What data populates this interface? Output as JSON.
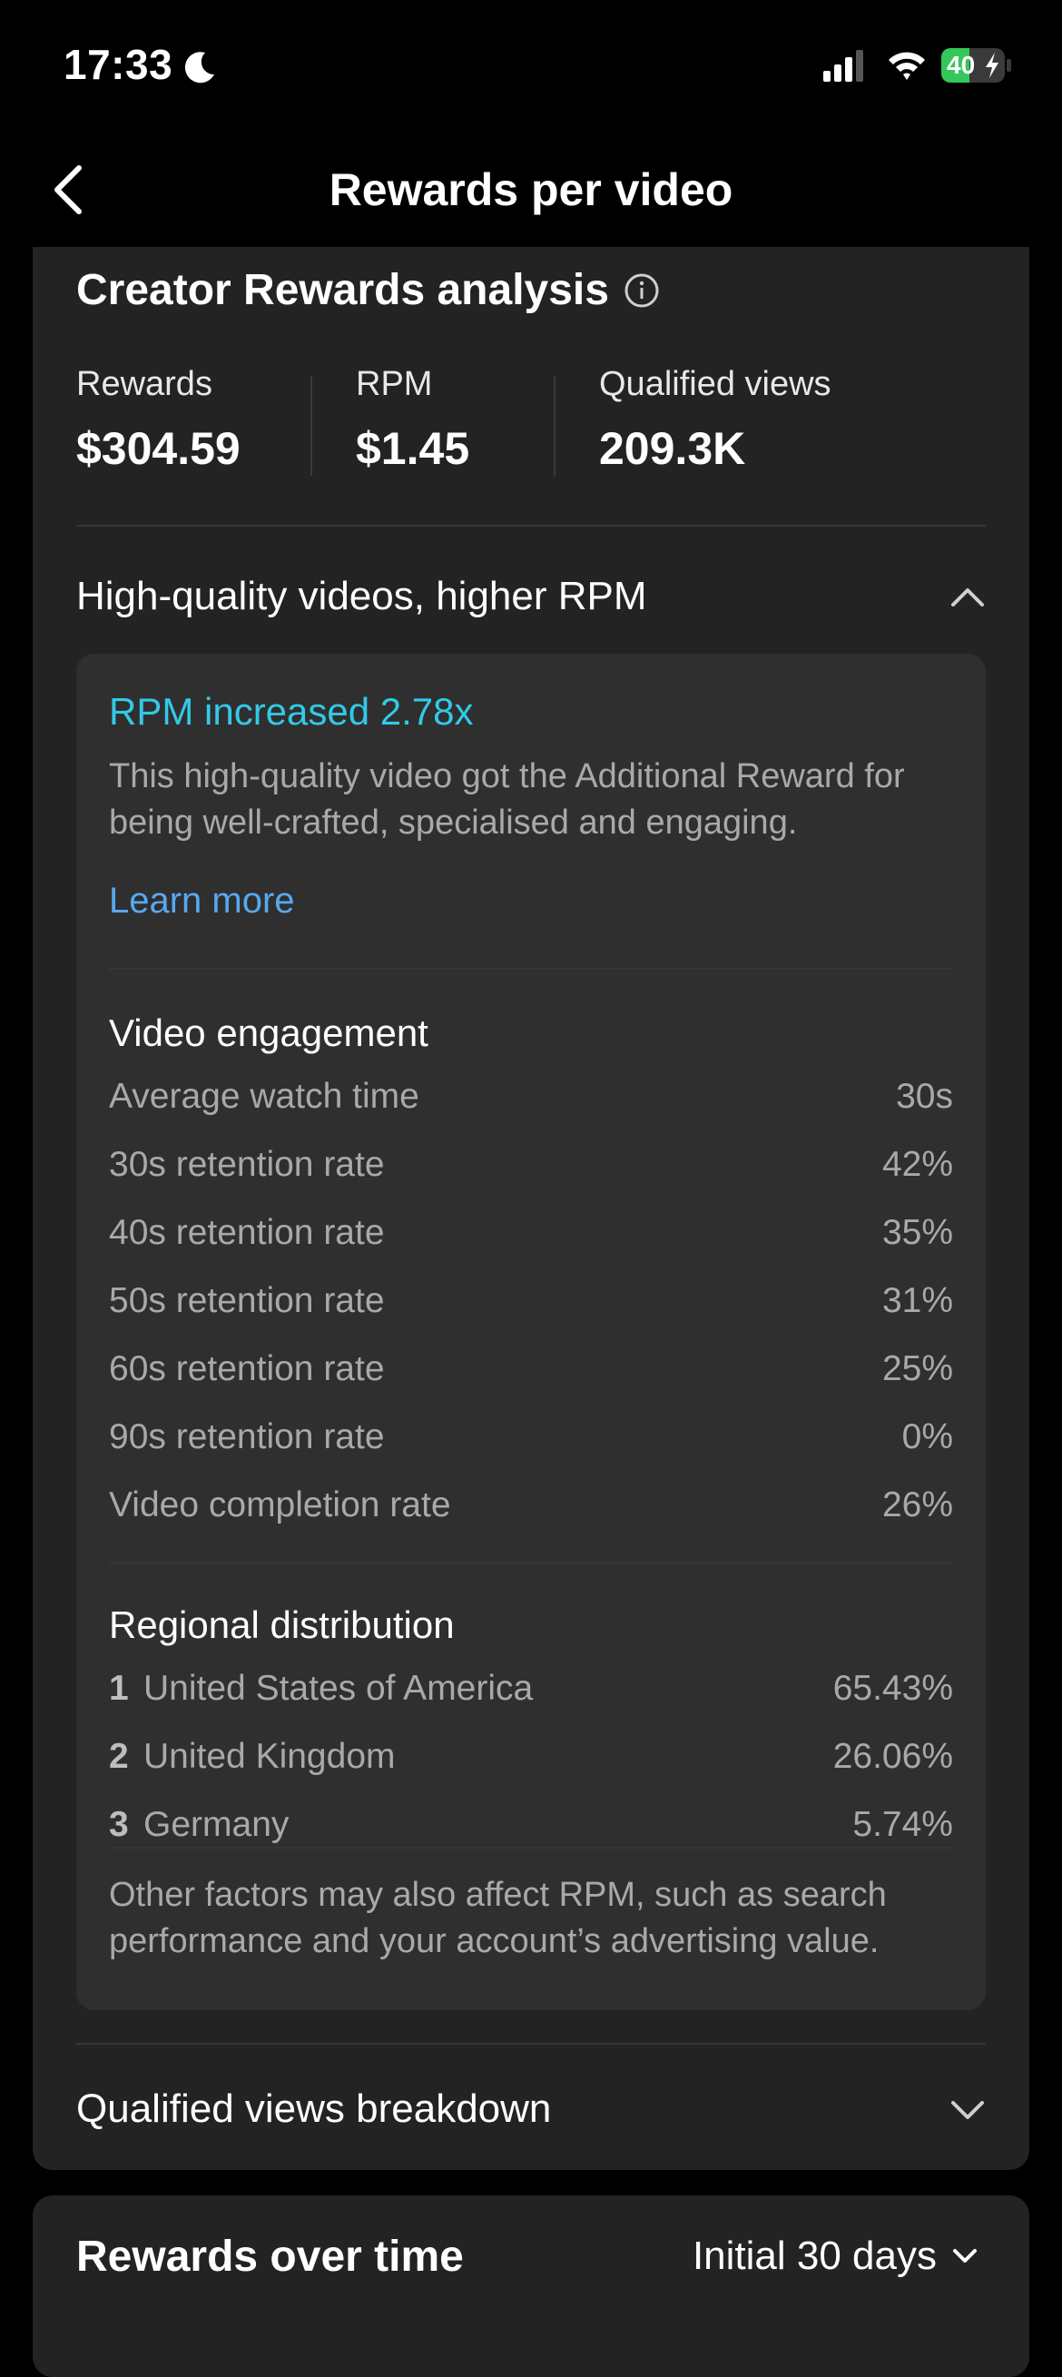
{
  "status_bar": {
    "time": "17:33",
    "battery": "40"
  },
  "header": {
    "title": "Rewards per video"
  },
  "analysis": {
    "title": "Creator Rewards analysis",
    "stats": [
      {
        "label": "Rewards",
        "value": "$304.59"
      },
      {
        "label": "RPM",
        "value": "$1.45"
      },
      {
        "label": "Qualified views",
        "value": "209.3K"
      }
    ]
  },
  "high_quality": {
    "label": "High-quality videos, higher RPM",
    "rpm_increase": "RPM increased 2.78x",
    "description": "This high-quality video got the Additional Reward for being well-crafted, specialised and engaging.",
    "learn_more": "Learn more",
    "engagement": {
      "title": "Video engagement",
      "rows": [
        {
          "label": "Average watch time",
          "value": "30s"
        },
        {
          "label": "30s retention rate",
          "value": "42%"
        },
        {
          "label": "40s retention rate",
          "value": "35%"
        },
        {
          "label": "50s retention rate",
          "value": "31%"
        },
        {
          "label": "60s retention rate",
          "value": "25%"
        },
        {
          "label": "90s retention rate",
          "value": "0%"
        },
        {
          "label": "Video completion rate",
          "value": "26%"
        }
      ]
    },
    "regional": {
      "title": "Regional distribution",
      "rows": [
        {
          "rank": "1",
          "label": "United States of America",
          "value": "65.43%"
        },
        {
          "rank": "2",
          "label": "United Kingdom",
          "value": "26.06%"
        },
        {
          "rank": "3",
          "label": "Germany",
          "value": "5.74%"
        }
      ]
    },
    "footnote": "Other factors may also affect RPM, such as search performance and your account’s advertising value."
  },
  "qualified_views": {
    "label": "Qualified views breakdown"
  },
  "rewards_over_time": {
    "title": "Rewards over time",
    "period": "Initial 30 days"
  },
  "colors": {
    "accent_cyan": "#33c9e8",
    "link_blue": "#58a8f0",
    "card_bg": "#232323",
    "inner_card_bg": "#2f2f2f",
    "battery_green": "#34c759"
  }
}
